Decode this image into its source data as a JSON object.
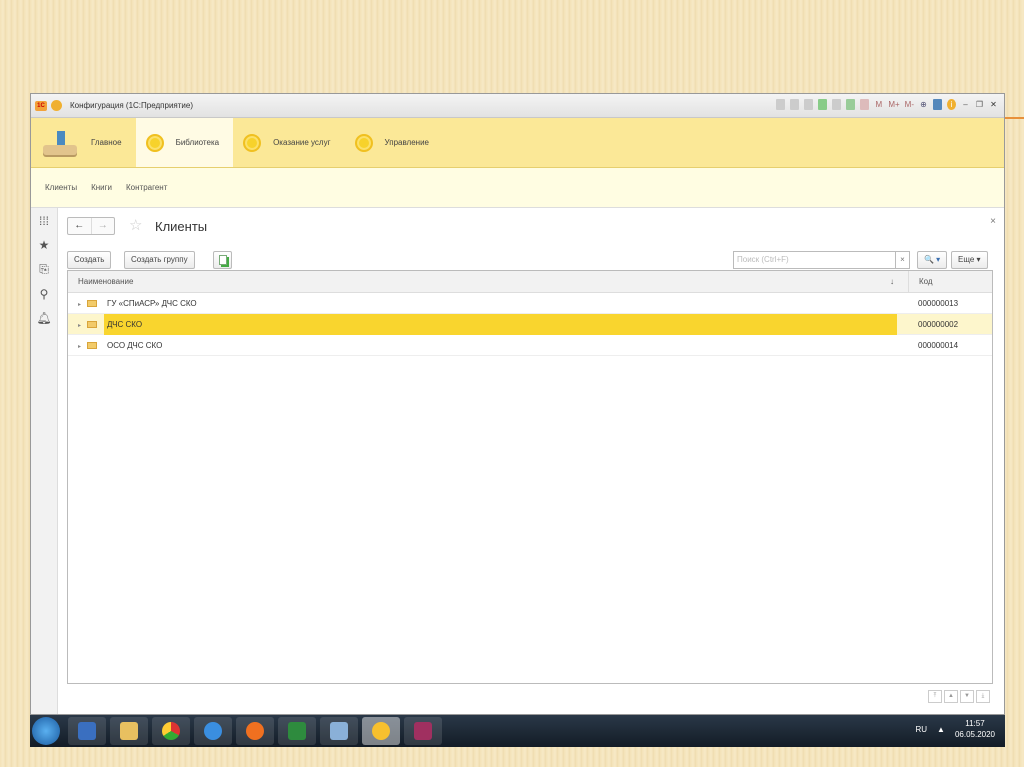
{
  "window": {
    "title": "Конфигурация (1С:Предприятие)",
    "logo": "1С",
    "toolbar_icons": [
      "save-icon",
      "print-icon",
      "preview-icon",
      "link-icon",
      "copy-icon",
      "calendar-icon",
      "calculator-icon"
    ],
    "memory": [
      "M",
      "M+",
      "M-"
    ]
  },
  "sections": [
    {
      "label": "Главное"
    },
    {
      "label": "Библиотека"
    },
    {
      "label": "Оказание услуг"
    },
    {
      "label": "Управление"
    }
  ],
  "subnav": [
    "Клиенты",
    "Книги",
    "Контрагент"
  ],
  "form": {
    "title": "Клиенты",
    "back": "←",
    "forward": "→",
    "close": "×",
    "buttons": {
      "create": "Создать",
      "create_group": "Создать группу",
      "more": "Еще ▾",
      "search_btn": "🔍 ▾"
    },
    "search_placeholder": "Поиск (Ctrl+F)",
    "search_clear": "×",
    "columns": {
      "name": "Наименование",
      "sort": "↓",
      "code": "Код"
    },
    "rows": [
      {
        "name": "ГУ «СПиАСР» ДЧС СКО",
        "code": "000000013"
      },
      {
        "name": "ДЧС СКО",
        "code": "000000002",
        "selected": true
      },
      {
        "name": "ОСО ДЧС СКО",
        "code": "000000014"
      }
    ]
  },
  "taskbar": {
    "lang": "RU",
    "time": "11:57",
    "date": "06.05.2020",
    "apps": [
      "word",
      "explorer",
      "chrome",
      "ie",
      "firefox",
      "excel",
      "tool",
      "1c",
      "winrar"
    ]
  }
}
